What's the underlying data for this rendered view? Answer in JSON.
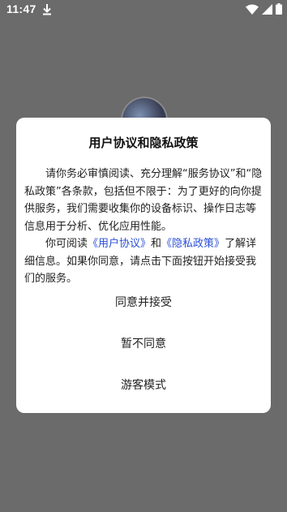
{
  "status_bar": {
    "time": "11:47",
    "icons": [
      "download-icon",
      "wifi-icon",
      "signal-icon",
      "battery-icon"
    ]
  },
  "dialog": {
    "title": "用户协议和隐私政策",
    "paragraph1": "请你务必审慎阅读、充分理解“服务协议”和“隐私政策”各条款，包括但不限于：为了更好的向你提供服务，我们需要收集你的设备标识、操作日志等信息用于分析、优化应用性能。",
    "paragraph2": {
      "lead": "你可阅读",
      "link_user_agreement": "《用户协议》",
      "and": "和",
      "link_privacy_policy": "《隐私政策》",
      "tail": "了解详细信息。如果你同意，请点击下面按钮开始接受我们的服务。"
    },
    "buttons": {
      "agree": "同意并接受",
      "disagree": "暂不同意",
      "guest": "游客模式"
    }
  },
  "colors": {
    "overlay": "#6b6b6b",
    "link": "#2b50d6",
    "dialog_bg": "#ffffff"
  }
}
